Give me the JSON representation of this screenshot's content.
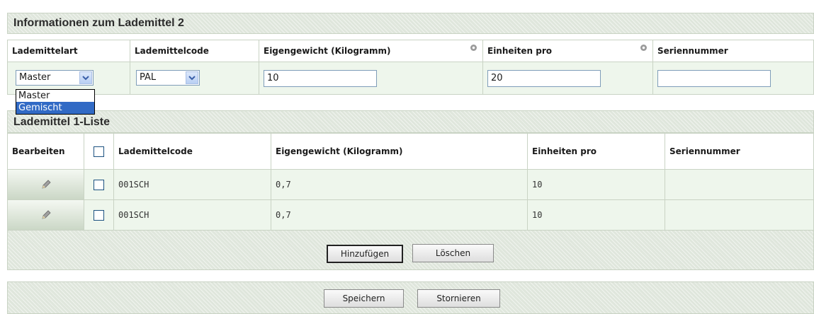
{
  "info_section": {
    "title": "Informationen zum Lademittel 2",
    "headers": [
      "Lademittelart",
      "Lademittelcode",
      "Eigengewicht (Kilogramm)",
      "Einheiten pro",
      "Seriennummer"
    ],
    "lademittelart": {
      "selected": "Master",
      "options": [
        "Master",
        "Gemischt"
      ],
      "highlighted": "Gemischt"
    },
    "lademittelcode": {
      "selected": "PAL"
    },
    "eigengewicht_value": "10",
    "einheiten_value": "20",
    "seriennummer_value": ""
  },
  "list_section": {
    "title": "Lademittel 1-Liste",
    "headers": {
      "edit": "Bearbeiten",
      "code": "Lademittelcode",
      "weight": "Eigengewicht (Kilogramm)",
      "units": "Einheiten pro",
      "serial": "Seriennummer"
    },
    "rows": [
      {
        "code": "001SCH",
        "weight": "0,7",
        "units": "10",
        "serial": ""
      },
      {
        "code": "001SCH",
        "weight": "0,7",
        "units": "10",
        "serial": ""
      }
    ],
    "add_label": "Hinzufügen",
    "delete_label": "Löschen"
  },
  "footer": {
    "save_label": "Speichern",
    "cancel_label": "Stornieren"
  },
  "icons": {
    "edit": "pencil-icon",
    "required": "gear-icon",
    "dropdown": "chevron-down-icon"
  },
  "colors": {
    "header_hatch": "#dfe6dc",
    "row_bg": "#eef6ec",
    "border": "#c9d3c4",
    "selection": "#316ac5"
  }
}
